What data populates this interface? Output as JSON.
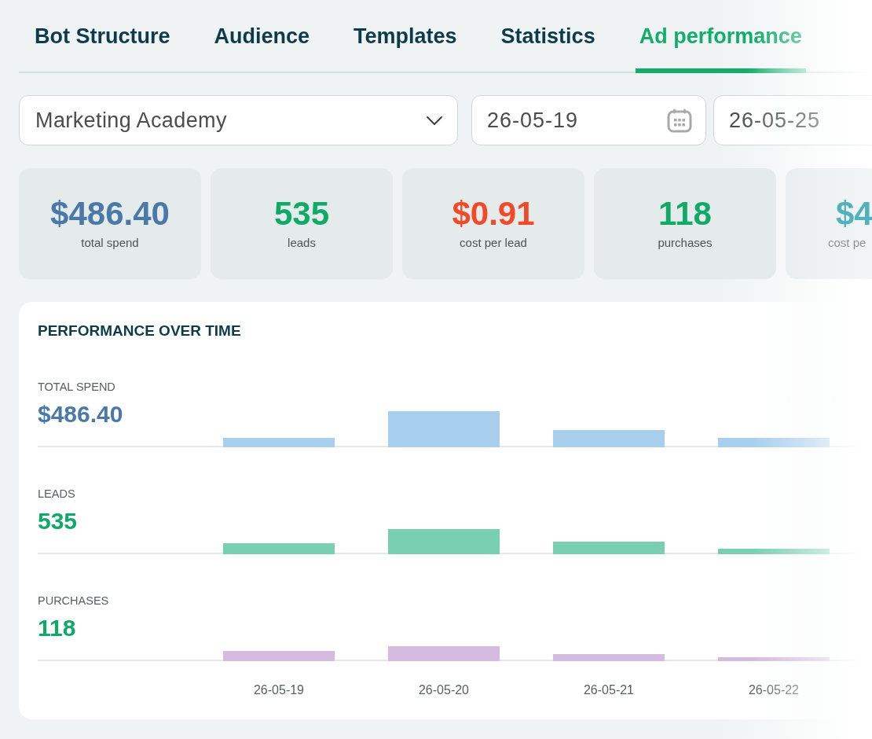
{
  "tabs": [
    {
      "label": "Bot Structure",
      "selected": false
    },
    {
      "label": "Audience",
      "selected": false
    },
    {
      "label": "Templates",
      "selected": false
    },
    {
      "label": "Statistics",
      "selected": false
    },
    {
      "label": "Ad performance",
      "selected": true
    }
  ],
  "filters": {
    "campaign": {
      "value": "Marketing Academy"
    },
    "date_from": {
      "value": "26-05-19"
    },
    "date_to": {
      "value": "26-05-25"
    }
  },
  "stat_cards": [
    {
      "value": "$486.40",
      "label": "total spend",
      "color": "#4a78a8"
    },
    {
      "value": "535",
      "label": "leads",
      "color": "#0fa968"
    },
    {
      "value": "$0.91",
      "label": "cost per lead",
      "color": "#f04a2a"
    },
    {
      "value": "118",
      "label": "purchases",
      "color": "#0fa968"
    },
    {
      "value": "$4",
      "label": "cost pe",
      "color": "#4fb2bd"
    }
  ],
  "chart": {
    "title": "PERFORMANCE OVER TIME",
    "rows": [
      {
        "label": "TOTAL SPEND",
        "total": "$486.40",
        "kind": "money",
        "color": "#a9cfee"
      },
      {
        "label": "LEADS",
        "total": "535",
        "kind": "count",
        "color": "#79cfb2"
      },
      {
        "label": "PURCHASES",
        "total": "118",
        "kind": "count",
        "color": "#d6bbe1"
      }
    ],
    "dates": [
      "26-05-19",
      "26-05-20",
      "26-05-21",
      "26-05-22"
    ]
  }
}
